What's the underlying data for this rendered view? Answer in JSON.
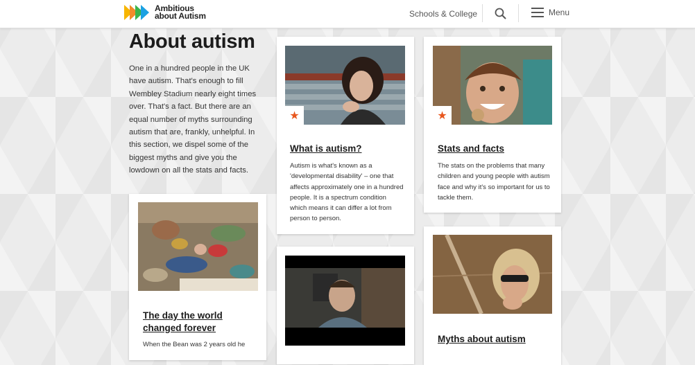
{
  "header": {
    "logo_line1": "Ambitious",
    "logo_line2": "about Autism",
    "nav_link": "Schools & College",
    "search_icon": "search-icon",
    "menu_label": "Menu",
    "menu_icon": "hamburger-icon"
  },
  "page": {
    "title": "About autism",
    "intro": "One in a hundred people in the UK have autism. That's enough to fill Wembley Stadium nearly eight times over. That's a fact. But there are an equal number of myths surrounding autism that are, frankly, unhelpful. In this section, we dispel some of the biggest myths and give you the lowdown on all the stats and facts."
  },
  "cards": [
    {
      "title": "What is autism?",
      "description": "Autism is what's known as a 'developmental disability' – one that affects approximately one in a hundred people. It is a spectrum condition which means it can differ a lot from person to person.",
      "badge": "★"
    },
    {
      "title": "Stats and facts",
      "description": "The stats on the problems that many children and young people with autism face and why it's so important for us to tackle them.",
      "badge": "★"
    },
    {
      "title": "The day the world changed forever",
      "description": "When the Bean was 2 years old he"
    },
    {
      "title": "",
      "description": ""
    },
    {
      "title": "Myths about autism",
      "description": ""
    }
  ],
  "colors": {
    "accent_orange": "#e8571e",
    "logo_yellow": "#f7b500",
    "logo_green": "#3bb44a",
    "logo_blue": "#1ba1e2"
  }
}
